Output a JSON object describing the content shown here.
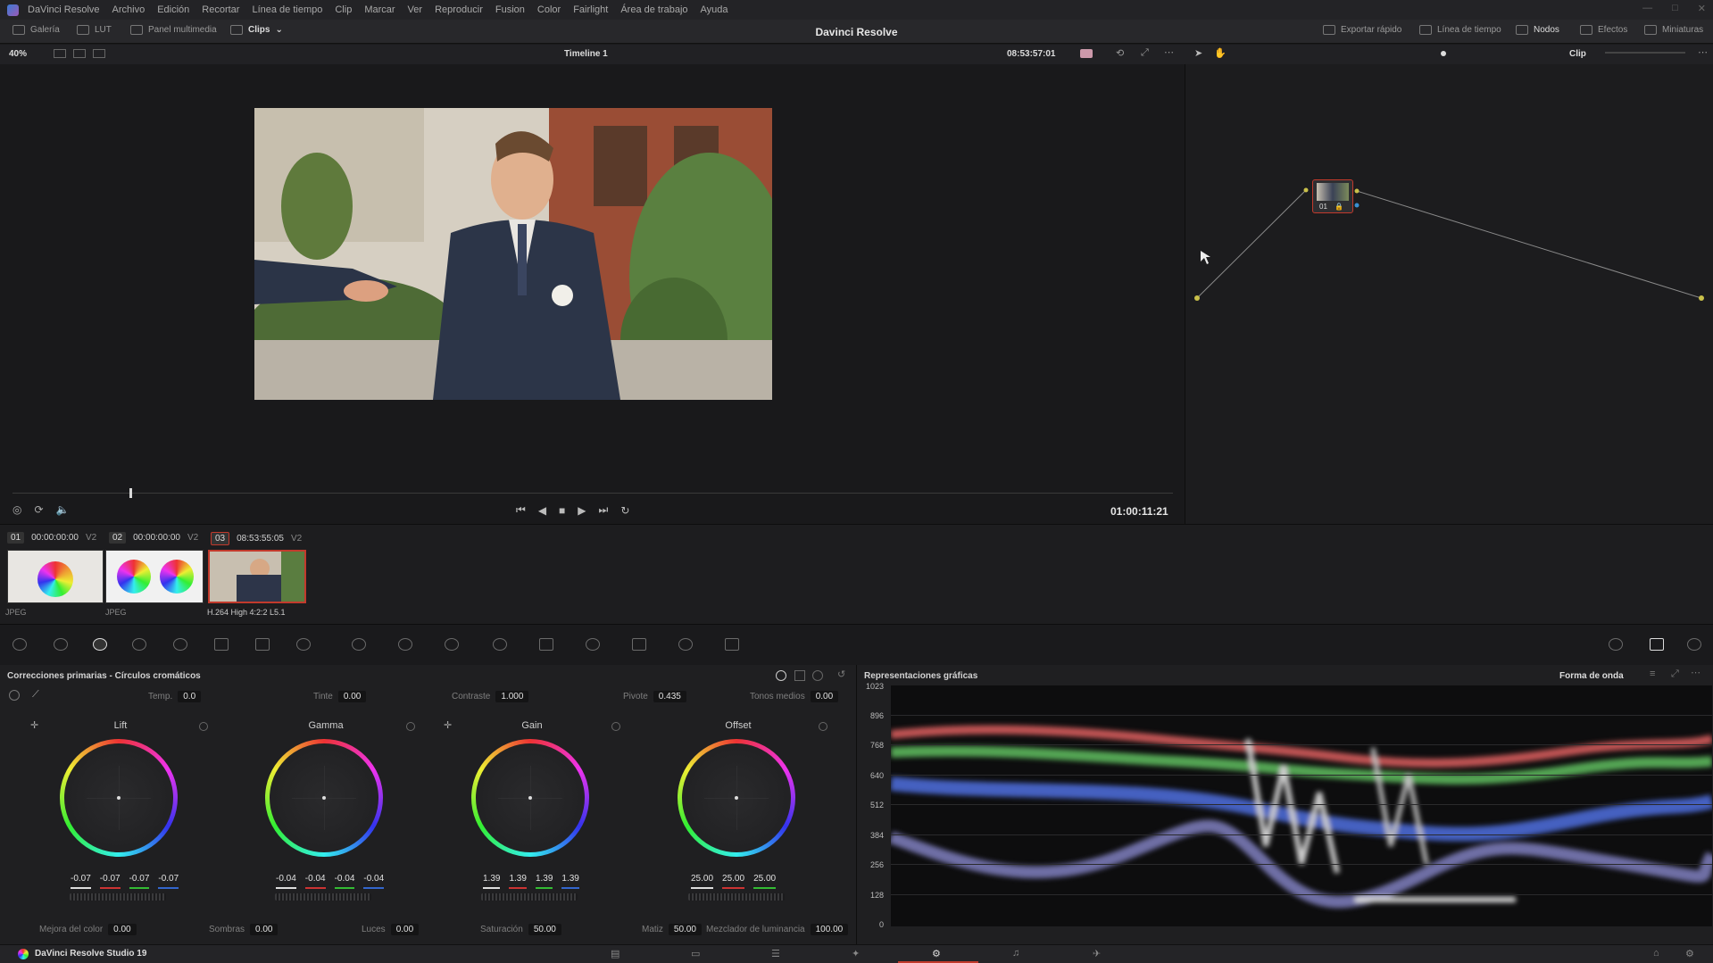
{
  "menu": {
    "app": "DaVinci Resolve",
    "items": [
      "Archivo",
      "Edición",
      "Recortar",
      "Línea de tiempo",
      "Clip",
      "Marcar",
      "Ver",
      "Reproducir",
      "Fusion",
      "Color",
      "Fairlight",
      "Área de trabajo",
      "Ayuda"
    ]
  },
  "toolbar": {
    "galeria": "Galería",
    "lut": "LUT",
    "panel": "Panel multimedia",
    "clips": "Clips",
    "exportar": "Exportar rápido",
    "linea": "Línea de tiempo",
    "nodos": "Nodos",
    "efectos": "Efectos",
    "miniaturas": "Miniaturas"
  },
  "title": "Davinci Resolve",
  "viewer": {
    "zoom": "40%",
    "timeline": "Timeline 1",
    "timecode_top": "08:53:57:01",
    "timecode": "01:00:11:21",
    "node_mode": "Clip"
  },
  "clips": [
    {
      "num": "01",
      "tc": "00:00:00:00",
      "track": "V2",
      "codec": "JPEG"
    },
    {
      "num": "02",
      "tc": "00:00:00:00",
      "track": "V2",
      "codec": "JPEG"
    },
    {
      "num": "03",
      "tc": "08:53:55:05",
      "track": "V2",
      "codec": "H.264 High 4:2:2 L5.1"
    }
  ],
  "node": {
    "label": "01"
  },
  "color": {
    "title": "Correcciones primarias - Círculos cromáticos",
    "temp_label": "Temp.",
    "temp": "0.0",
    "tinte_label": "Tinte",
    "tinte": "0.00",
    "contraste_label": "Contraste",
    "contraste": "1.000",
    "pivote_label": "Pivote",
    "pivote": "0.435",
    "tonos_label": "Tonos medios",
    "tonos": "0.00",
    "wheels": [
      {
        "name": "Lift",
        "vals": [
          "-0.07",
          "-0.07",
          "-0.07",
          "-0.07"
        ]
      },
      {
        "name": "Gamma",
        "vals": [
          "-0.04",
          "-0.04",
          "-0.04",
          "-0.04"
        ]
      },
      {
        "name": "Gain",
        "vals": [
          "1.39",
          "1.39",
          "1.39",
          "1.39"
        ]
      },
      {
        "name": "Offset",
        "vals": [
          "25.00",
          "25.00",
          "25.00"
        ]
      }
    ],
    "mejora_label": "Mejora del color",
    "mejora": "0.00",
    "sombras_label": "Sombras",
    "sombras": "0.00",
    "luces_label": "Luces",
    "luces": "0.00",
    "saturacion_label": "Saturación",
    "saturacion": "50.00",
    "matiz_label": "Matiz",
    "matiz": "50.00",
    "mezclador_label": "Mezclador de luminancia",
    "mezclador": "100.00"
  },
  "scopes": {
    "title": "Representaciones gráficas",
    "mode": "Forma de onda",
    "ticks": [
      "1023",
      "896",
      "768",
      "640",
      "512",
      "384",
      "256",
      "128",
      "0"
    ]
  },
  "status": {
    "app": "DaVinci Resolve Studio 19"
  }
}
